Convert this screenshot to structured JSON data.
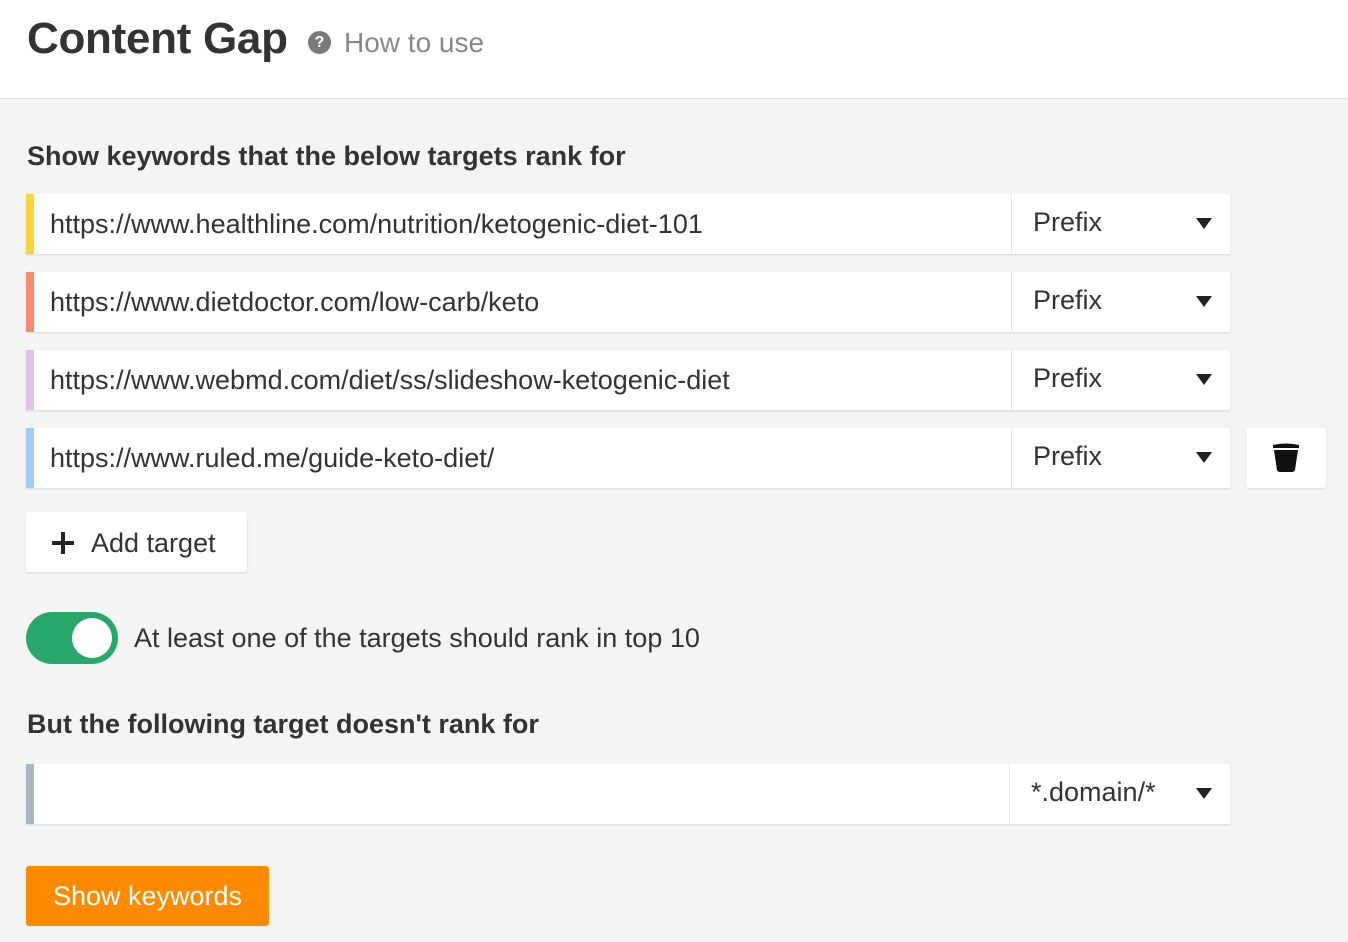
{
  "header": {
    "title": "Content Gap",
    "help_icon_glyph": "?",
    "help_link": "How to use"
  },
  "include_section": {
    "heading": "Show keywords that the below targets rank for",
    "targets": [
      {
        "url": "https://www.healthline.com/nutrition/ketogenic-diet-101",
        "mode": "Prefix",
        "color": "#f8d63a"
      },
      {
        "url": "https://www.dietdoctor.com/low-carb/keto",
        "mode": "Prefix",
        "color": "#f98b6b"
      },
      {
        "url": "https://www.webmd.com/diet/ss/slideshow-ketogenic-diet",
        "mode": "Prefix",
        "color": "#e2c2ea"
      },
      {
        "url": "https://www.ruled.me/guide-keto-diet/",
        "mode": "Prefix",
        "color": "#9fcdf7"
      }
    ],
    "delete_icon": "trash-icon",
    "add_target_label": "Add target",
    "add_icon": "plus-icon"
  },
  "toggle": {
    "on": true,
    "color": "#27a86a",
    "label": "At least one of the targets should rank in top 10"
  },
  "exclude_section": {
    "heading": "But the following target doesn't rank for",
    "target": {
      "url": "",
      "mode": "*.domain/*",
      "color": "#aab7c2"
    }
  },
  "submit": {
    "label": "Show keywords",
    "color": "#ff8a00"
  }
}
